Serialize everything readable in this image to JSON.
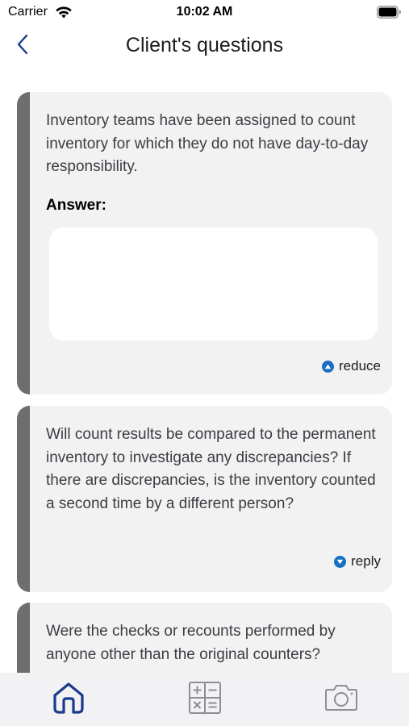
{
  "status_bar": {
    "carrier": "Carrier",
    "time": "10:02 AM"
  },
  "nav": {
    "title": "Client's questions",
    "back_icon": "chevron-left-icon",
    "accent_color": "#1b3a8c"
  },
  "cards": [
    {
      "question": "Inventory teams have been assigned to count inventory for which they do not have day-to-day responsibility.",
      "answer_label": "Answer:",
      "answer_value": "",
      "toggle_label": "reduce",
      "toggle_icon": "chevron-up-circle-icon",
      "expanded": true
    },
    {
      "question": "Will count results be compared to the permanent inventory to investigate any discrepancies? If there are discrepancies, is the inventory counted a second time by a different person?",
      "toggle_label": "reply",
      "toggle_icon": "chevron-down-circle-icon",
      "expanded": false
    },
    {
      "question": "Were the checks or recounts performed by anyone other than the original counters?",
      "expanded": false
    }
  ],
  "tab_bar": {
    "tabs": [
      {
        "icon": "home-icon",
        "active": true
      },
      {
        "icon": "calculator-icon",
        "active": false
      },
      {
        "icon": "camera-icon",
        "active": false
      }
    ],
    "active_color": "#1b3a8c",
    "inactive_color": "#8e8e93"
  }
}
